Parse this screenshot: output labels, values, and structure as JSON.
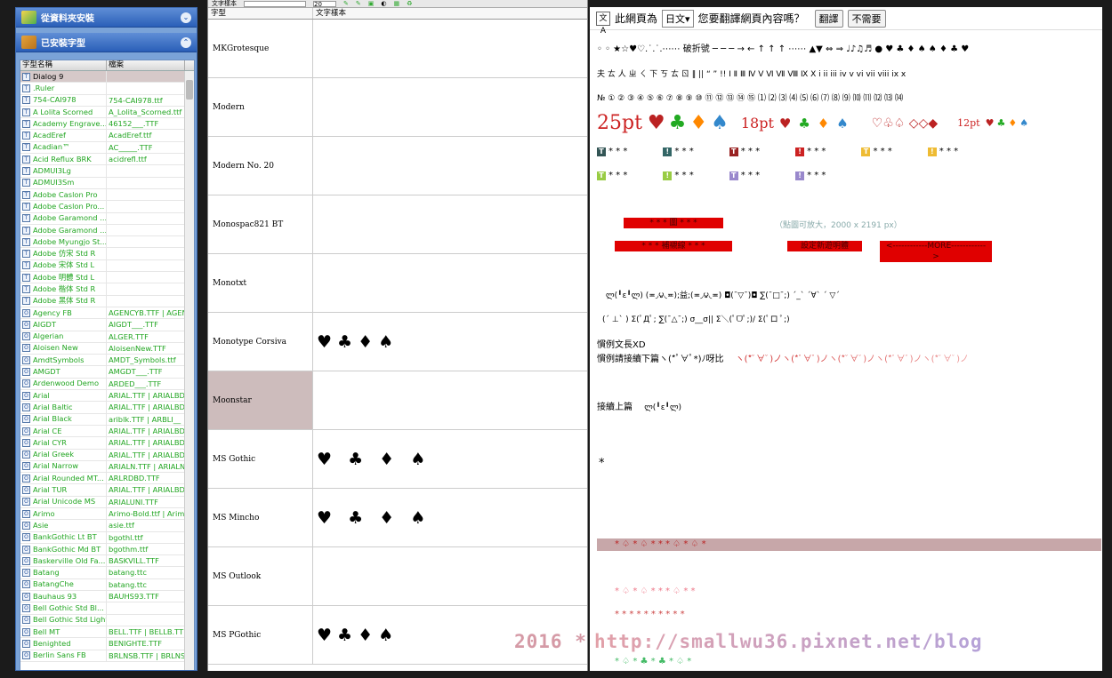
{
  "left_panel": {
    "folder_header": "從資料夾安裝",
    "installed_header": "已安裝字型",
    "col_name": "字型名稱",
    "col_file": "檔案",
    "fonts": [
      {
        "name": "Dialog 9",
        "file": "",
        "style": "sel"
      },
      {
        "name": ".Ruler",
        "file": "",
        "style": "green"
      },
      {
        "name": "754-CAI978",
        "file": "754-CAI978.ttf",
        "style": "green"
      },
      {
        "name": "A Lolita Scorned",
        "file": "A_Lolita_Scorned.ttf",
        "style": "green"
      },
      {
        "name": "Academy Engrave...",
        "file": "46152___.TTF",
        "style": "green"
      },
      {
        "name": "AcadEref",
        "file": "AcadEref.ttf",
        "style": "green"
      },
      {
        "name": "Acadian™",
        "file": "AC_____.TTF",
        "style": "green"
      },
      {
        "name": "Acid Reflux BRK",
        "file": "acidrefl.ttf",
        "style": "green"
      },
      {
        "name": "ADMUI3Lg",
        "file": "",
        "style": "green"
      },
      {
        "name": "ADMUI3Sm",
        "file": "",
        "style": "green"
      },
      {
        "name": "Adobe Caslon Pro",
        "file": "",
        "style": "green"
      },
      {
        "name": "Adobe Caslon Pro...",
        "file": "",
        "style": "green"
      },
      {
        "name": "Adobe Garamond ...",
        "file": "",
        "style": "green"
      },
      {
        "name": "Adobe Garamond ...",
        "file": "",
        "style": "green"
      },
      {
        "name": "Adobe Myungjo St...",
        "file": "",
        "style": "green"
      },
      {
        "name": "Adobe 仿宋 Std R",
        "file": "",
        "style": "green"
      },
      {
        "name": "Adobe 宋体 Std L",
        "file": "",
        "style": "green"
      },
      {
        "name": "Adobe 明體 Std L",
        "file": "",
        "style": "green"
      },
      {
        "name": "Adobe 楷体 Std R",
        "file": "",
        "style": "green"
      },
      {
        "name": "Adobe 黑体 Std R",
        "file": "",
        "style": "green"
      },
      {
        "name": "Agency FB",
        "file": "AGENCYB.TTF | AGEN",
        "style": "green"
      },
      {
        "name": "AIGDT",
        "file": "AIGDT___.TTF",
        "style": "green"
      },
      {
        "name": "Algerian",
        "file": "ALGER.TTF",
        "style": "green"
      },
      {
        "name": "Aloisen New",
        "file": "AloisenNew.TTF",
        "style": "green"
      },
      {
        "name": "AmdtSymbols",
        "file": "AMDT_Symbols.ttf",
        "style": "green"
      },
      {
        "name": "AMGDT",
        "file": "AMGDT___.TTF",
        "style": "green"
      },
      {
        "name": "Ardenwood Demo",
        "file": "ARDED___.TTF",
        "style": "green"
      },
      {
        "name": "Arial",
        "file": "ARIAL.TTF | ARIALBD",
        "style": "green"
      },
      {
        "name": "Arial Baltic",
        "file": "ARIAL.TTF | ARIALBD",
        "style": "green"
      },
      {
        "name": "Arial Black",
        "file": "ariblk.TTF | ARBLI__",
        "style": "green"
      },
      {
        "name": "Arial CE",
        "file": "ARIAL.TTF | ARIALBD",
        "style": "green"
      },
      {
        "name": "Arial CYR",
        "file": "ARIAL.TTF | ARIALBD",
        "style": "green"
      },
      {
        "name": "Arial Greek",
        "file": "ARIAL.TTF | ARIALBD",
        "style": "green"
      },
      {
        "name": "Arial Narrow",
        "file": "ARIALN.TTF | ARIALN",
        "style": "green"
      },
      {
        "name": "Arial Rounded MT...",
        "file": "ARLRDBD.TTF",
        "style": "green"
      },
      {
        "name": "Arial TUR",
        "file": "ARIAL.TTF | ARIALBD",
        "style": "green"
      },
      {
        "name": "Arial Unicode MS",
        "file": "ARIALUNI.TTF",
        "style": "green"
      },
      {
        "name": "Arimo",
        "file": "Arimo-Bold.ttf | Arimo-R",
        "style": "green"
      },
      {
        "name": "Asie",
        "file": "asie.ttf",
        "style": "green"
      },
      {
        "name": "BankGothic Lt BT",
        "file": "bgothl.ttf",
        "style": "green"
      },
      {
        "name": "BankGothic Md BT",
        "file": "bgothm.ttf",
        "style": "green"
      },
      {
        "name": "Baskerville Old Fa...",
        "file": "BASKVILL.TTF",
        "style": "green"
      },
      {
        "name": "Batang",
        "file": "batang.ttc",
        "style": "green"
      },
      {
        "name": "BatangChe",
        "file": "batang.ttc",
        "style": "green"
      },
      {
        "name": "Bauhaus 93",
        "file": "BAUHS93.TTF",
        "style": "green"
      },
      {
        "name": "Bell Gothic Std Bl...",
        "file": "",
        "style": "green"
      },
      {
        "name": "Bell Gothic Std Light",
        "file": "",
        "style": "green"
      },
      {
        "name": "Bell MT",
        "file": "BELL.TTF | BELLB.TT",
        "style": "green"
      },
      {
        "name": "Benighted",
        "file": "BENIGHTE.TTF",
        "style": "green"
      },
      {
        "name": "Berlin Sans FB",
        "file": "BRLNSB.TTF | BRLNS",
        "style": "green"
      }
    ]
  },
  "middle_panel": {
    "toolbar_label": "文字樣本",
    "size_value": "20",
    "col_font": "字型",
    "col_sample": "文字樣本",
    "samples": [
      {
        "font": "MKGrotesque",
        "sample": ""
      },
      {
        "font": "Modern",
        "sample": ""
      },
      {
        "font": "Modern No. 20",
        "sample": ""
      },
      {
        "font": "Monospac821 BT",
        "sample": ""
      },
      {
        "font": "Monotxt",
        "sample": ""
      },
      {
        "font": "Monotype Corsiva",
        "sample": "♥♣♦♠"
      },
      {
        "font": "Moonstar",
        "sample": "",
        "highlight": true
      },
      {
        "font": "MS Gothic",
        "sample": "♥ ♣ ♦ ♠"
      },
      {
        "font": "MS Mincho",
        "sample": "♥ ♣ ♦ ♠"
      },
      {
        "font": "MS Outlook",
        "sample": ""
      },
      {
        "font": "MS PGothic",
        "sample": "♥♣♦♠"
      }
    ]
  },
  "translate_bar": {
    "prefix": "此網頁為",
    "language": "日文",
    "question": "您要翻譯網頁內容嗎？",
    "translate_btn": "翻譯",
    "no_btn": "不需要"
  },
  "content": {
    "line1": "◦ ◦ ★☆♥♡.˙.˙.⋯⋯ 破折號 ─ ─ ─ → ← ↑ ↑ ↑ ⋯⋯   ▲▼   ⇔ ⇒    ♩♪♫♬     ●          ♥  ♣  ♦  ♠        ♠  ♦  ♣  ♥",
    "line2": "夫 ㄊ 人     ㄓ ㄑ 下     ㄎ ㄊ ㄖ     ‖ ||      “     ”         !!          Ⅰ  Ⅱ  Ⅲ  Ⅳ  Ⅴ  Ⅵ  Ⅶ  Ⅷ  Ⅸ  Ⅹ           i  ii iii iv v vi vii viii ix x",
    "line3": "№ ① ② ③ ④ ⑤ ⑥ ⑦ ⑧ ⑨ ⑩ ⑪ ⑫ ⑬ ⑭ ⑮    ⑴ ⑵ ⑶ ⑷ ⑸ ⑹ ⑺ ⑻ ⑼ ⑽ ⑾ ⑿ ⒀ ⒁",
    "pt25": "25pt",
    "pt18": "18pt",
    "pt12": "12pt",
    "suits": "♥ ♣ ♦ ♠",
    "outline_suits": "♡♧♤ ◇◇◆",
    "stars": "* * *",
    "bar1": "* * *    圖    * * *",
    "bar2": "* * *   補襯線   * * *",
    "bar3": "設定新遊明體",
    "bar4": "<------------MORE------------>",
    "zoom_note": "（點圖可放大，2000 x 2191 px）",
    "kaomoji1": "ლ(╹ε╹ლ)           (≖◞౪◟≖);益;(≖◞౪◟≖)            ◘(¯▽¯)◘                     ∑(¯□¯;)                    ˊ_ˋ      ˊ∀ˋ  ˊ ▽ˊ",
    "kaomoji2": "(´ ⊥` )          Σ(ﾟДﾟ;          ∑(¯△¯;)           σ__σ||          Σ＼(ﾟᗜﾟ;)/            Σ(ﾟロ ﾟ;)",
    "text1": "慣例文長XD",
    "text2": "慣例請接續下篇ヽ(*ﾟ∀ﾟ*)ﾉ呀比",
    "text2_emo": "ヽ(*ﾟ∀ﾟ)ノヽ(*ﾟ∀ﾟ)ノヽ(*ﾟ∀ﾟ)ノヽ(*ﾟ∀ﾟ)ノヽ(*ﾟ∀ﾟ)ノ",
    "text3": "接續上篇",
    "text3_emo": "ლ(╹ε╹ლ)",
    "lone_star": "*",
    "band_marks": "*          ♤          *          ♤          *          *          *          ♤          *          ♤          *",
    "row_a": "*          ♤          *          ♤          *          *          *          ♤          *          *",
    "row_b": "*          *          *          *          *          *          *          *          *          *",
    "row_c": "*          ♤          *          ♣          *          ♣          *          ♤          *",
    "watermark_year": "2016 *",
    "watermark_url": "http://smallwu36.pixnet.net/blog"
  }
}
